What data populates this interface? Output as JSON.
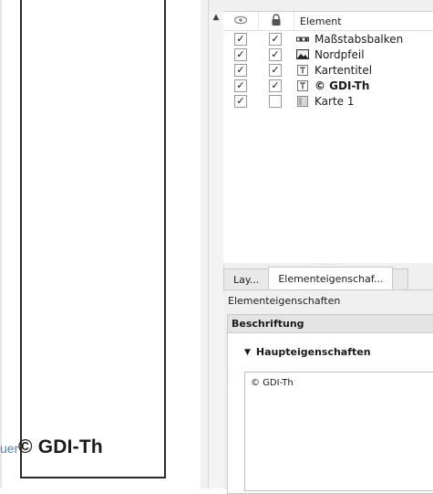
{
  "canvas": {
    "bleed_text": "uer",
    "copyright_label": "© GDI-Th"
  },
  "items_panel": {
    "header": {
      "element": "Element"
    },
    "rows": [
      {
        "visible": true,
        "locked": true,
        "icon": "scalebar-icon",
        "label": "Maßstabsbalken",
        "bold": false
      },
      {
        "visible": true,
        "locked": true,
        "icon": "picture-icon",
        "label": "Nordpfeil",
        "bold": false
      },
      {
        "visible": true,
        "locked": true,
        "icon": "text-label-icon",
        "label": "Kartentitel",
        "bold": false
      },
      {
        "visible": true,
        "locked": true,
        "icon": "text-label-icon",
        "label": "© GDI-Th",
        "bold": true
      },
      {
        "visible": true,
        "locked": false,
        "icon": "map-icon",
        "label": "Karte 1",
        "bold": false
      }
    ]
  },
  "tabs": [
    {
      "label": "Lay...",
      "active": false
    },
    {
      "label": "Elementeigenschaf...",
      "active": true
    },
    {
      "label": "",
      "active": false
    }
  ],
  "properties": {
    "title": "Elementeigenschaften",
    "section": "Beschriftung",
    "group": "Haupteigenschaften",
    "text_value": "© GDI-Th"
  },
  "colors": {
    "bleed_text": "#4f86c6",
    "panel_bg": "#f0f0f0",
    "section_header_bg": "#e3e3e3"
  }
}
